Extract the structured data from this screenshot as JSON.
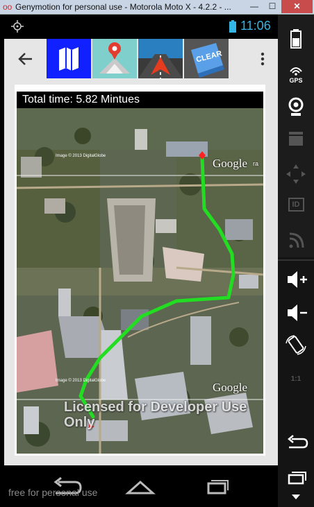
{
  "window": {
    "title": "Genymotion for personal use - Motorola Moto X - 4.2.2 - ...",
    "minimize": "—",
    "maximize": "☐",
    "close": "✕"
  },
  "status_bar": {
    "time": "11:06"
  },
  "action_bar": {
    "tiles": [
      "map-icon",
      "pin-icon",
      "navigation-icon",
      "clear-icon"
    ],
    "clear_tile_label": "CLEAR"
  },
  "card": {
    "total_time_label": "Total time: 5.82 Mintues",
    "map_labels": {
      "google_top": "Google",
      "google_top_suffix": "ra",
      "google_bottom": "Google",
      "copyright_top": "Image © 2013 DigitalGlobe",
      "copyright_bottom": "Image © 2013 DigitalGlobe"
    },
    "watermark": "Licensed for Developer Use Only"
  },
  "nav_bar": {
    "keys": [
      "back",
      "home",
      "recents"
    ]
  },
  "footer_text": "free for personal use",
  "sidebar": {
    "items": [
      {
        "icon": "battery-icon",
        "label": ""
      },
      {
        "icon": "gps-icon",
        "label": "GPS"
      },
      {
        "icon": "camera-icon",
        "label": ""
      },
      {
        "icon": "video-icon",
        "label": ""
      },
      {
        "icon": "dpad-icon",
        "label": ""
      },
      {
        "icon": "id-icon",
        "label": "ID"
      },
      {
        "icon": "cast-icon",
        "label": ""
      },
      {
        "icon": "volume-up-icon",
        "label": ""
      },
      {
        "icon": "volume-down-icon",
        "label": ""
      },
      {
        "icon": "rotate-icon",
        "label": ""
      },
      {
        "icon": "scale-icon",
        "label": "1:1"
      },
      {
        "icon": "back-icon",
        "label": ""
      },
      {
        "icon": "recent-apps-icon",
        "label": ""
      }
    ]
  },
  "colors": {
    "route": "#22dd22",
    "start_marker": "#ff2020",
    "time_accent": "#33b5e5",
    "map_tile_blue": "#1020ff"
  }
}
